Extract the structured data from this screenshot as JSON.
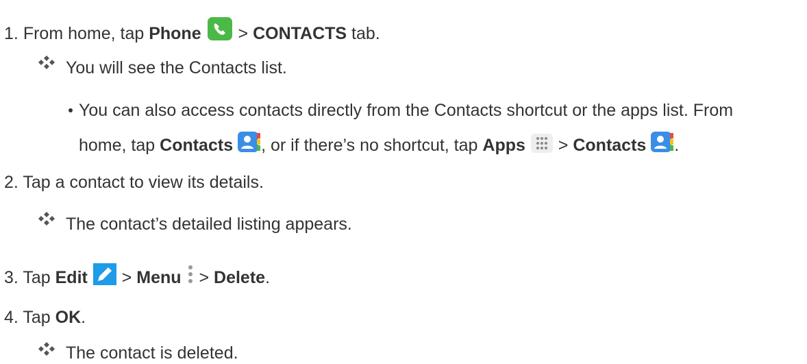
{
  "steps": [
    {
      "number": "1.",
      "parts": [
        "From home, tap ",
        "Phone",
        " > ",
        "CONTACTS",
        " tab."
      ],
      "result": "You will see the Contacts list.",
      "note_line1": "You can also access contacts directly from the Contacts shortcut or the apps list. From",
      "note_line2": [
        "home, tap ",
        "Contacts",
        ", or if there’s no shortcut, tap ",
        "Apps",
        " > ",
        "Contacts",
        "."
      ]
    },
    {
      "number": "2.",
      "parts": [
        "Tap a contact to view its details."
      ],
      "result": "The contact’s detailed listing appears."
    },
    {
      "number": "3.",
      "parts": [
        "Tap ",
        "Edit",
        " > ",
        "Menu",
        " > ",
        "Delete",
        "."
      ]
    },
    {
      "number": "4.",
      "parts": [
        "Tap ",
        "OK",
        "."
      ],
      "result": "The contact is deleted."
    }
  ],
  "icons": {
    "phone": "phone-app-icon",
    "contacts": "contacts-app-icon",
    "apps": "apps-grid-icon",
    "edit": "edit-pencil-icon",
    "menu": "menu-dots-icon",
    "result_bullet": "diamond-bullet-icon"
  },
  "colors": {
    "text": "#333333",
    "phone_green": "#4cb848",
    "contacts_blue": "#3a8ee6",
    "edit_blue": "#1e9be9"
  }
}
